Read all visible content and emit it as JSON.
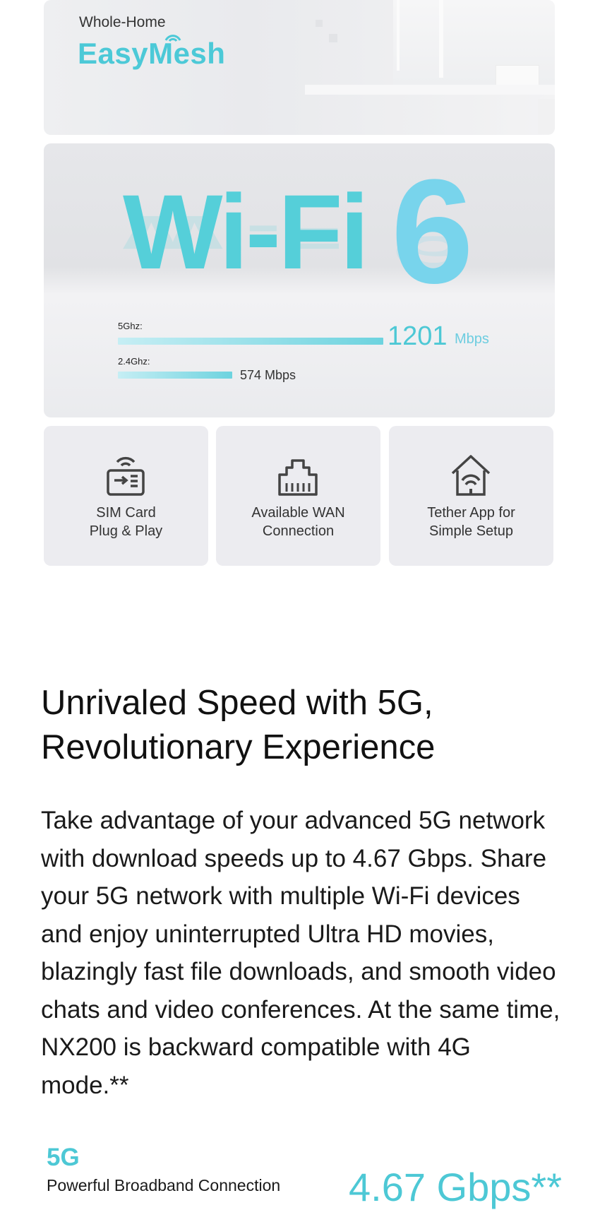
{
  "easymesh": {
    "kicker": "Whole-Home",
    "title": "EasyMesh"
  },
  "wifi6": {
    "title": "Wi-Fi",
    "number": "6",
    "bands": [
      {
        "label": "5Ghz:",
        "speed": "1201",
        "unit": "Mbps"
      },
      {
        "label": "2.4Ghz:",
        "speed_text": "574 Mbps"
      }
    ]
  },
  "features": [
    {
      "line1": "SIM Card",
      "line2": "Plug & Play",
      "icon": "sim-card-icon"
    },
    {
      "line1": "Available WAN",
      "line2": "Connection",
      "icon": "ethernet-port-icon"
    },
    {
      "line1": "Tether App for",
      "line2": "Simple Setup",
      "icon": "home-wifi-icon"
    }
  ],
  "section": {
    "headline_line1": "Unrivaled Speed with 5G,",
    "headline_line2": "Revolutionary Experience",
    "body": "Take advantage of your advanced 5G network with download speeds up to 4.67 Gbps. Share your 5G network with multiple Wi-Fi devices and enjoy uninterrupted Ultra HD movies, blazingly fast file downloads, and smooth video chats and video conferences. At the same time, NX200 is backward compatible with 4G mode.**"
  },
  "stat": {
    "label": "5G",
    "sub": "Powerful Broadband Connection",
    "value": "4.67 Gbps**"
  },
  "colors": {
    "accent": "#4dc8d5",
    "card_bg": "#ececf0"
  }
}
